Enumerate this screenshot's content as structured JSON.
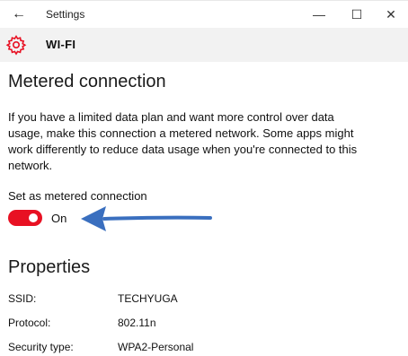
{
  "window": {
    "title": "Settings",
    "back_icon": "back-arrow-icon",
    "controls": {
      "minimize": "—",
      "maximize": "☐",
      "close": "✕"
    }
  },
  "header": {
    "title": "WI-FI",
    "icon": "gear-icon",
    "accent": "#e81123"
  },
  "metered": {
    "heading": "Metered connection",
    "description": "If you have a limited data plan and want more control over data usage, make this connection a metered network. Some apps might work differently to reduce data usage when you're connected to this network.",
    "toggle_label": "Set as metered connection",
    "toggle_on": true,
    "toggle_state": "On",
    "toggle_color": "#e81123",
    "annotation_arrow_color": "#3a6fbf"
  },
  "properties": {
    "heading": "Properties",
    "rows": [
      {
        "key": "SSID:",
        "value": "TECHYUGA"
      },
      {
        "key": "Protocol:",
        "value": "802.11n"
      },
      {
        "key": "Security type:",
        "value": "WPA2-Personal"
      }
    ]
  }
}
